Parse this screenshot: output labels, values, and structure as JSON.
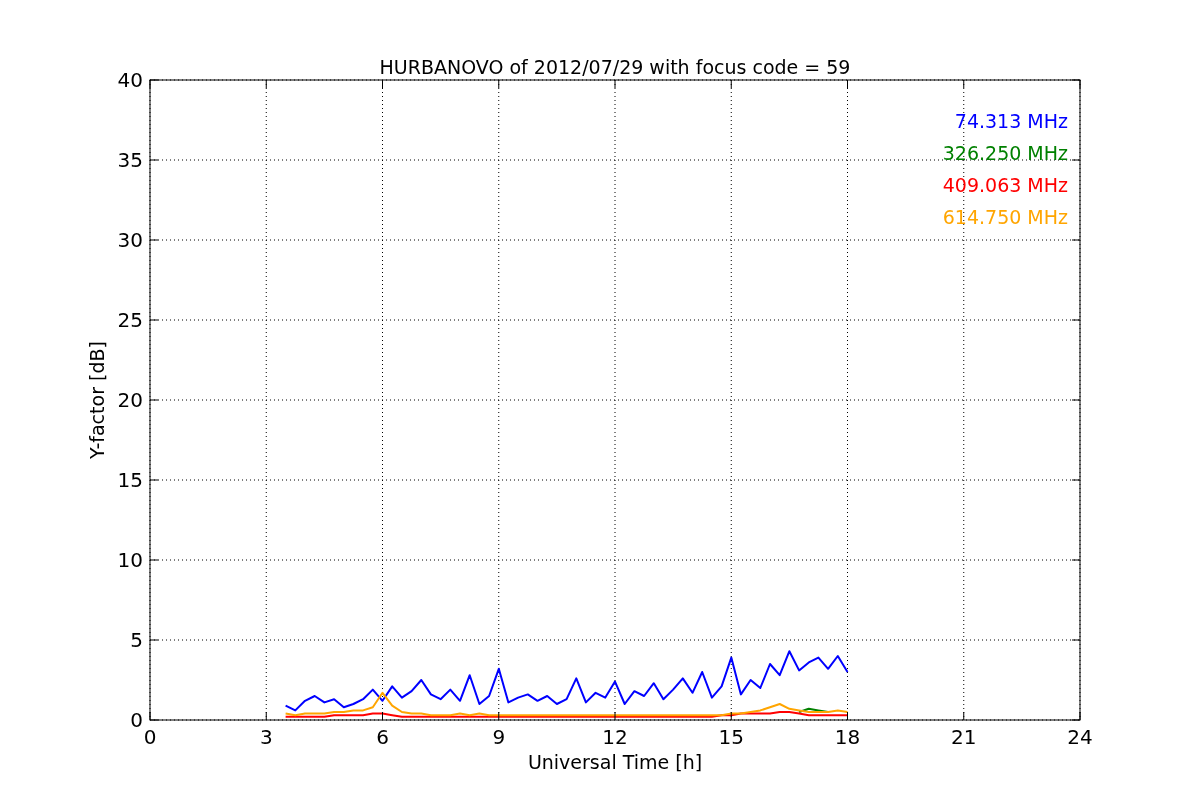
{
  "chart_data": {
    "type": "line",
    "title": "HURBANOVO of 2012/07/29 with focus code = 59",
    "xlabel": "Universal Time [h]",
    "ylabel": "Y-factor [dB]",
    "xlim": [
      0,
      24
    ],
    "ylim": [
      0,
      40
    ],
    "xticks": [
      0,
      3,
      6,
      9,
      12,
      15,
      18,
      21,
      24
    ],
    "yticks": [
      0,
      5,
      10,
      15,
      20,
      25,
      30,
      35,
      40
    ],
    "grid": true,
    "x": [
      3.5,
      3.75,
      4,
      4.25,
      4.5,
      4.75,
      5,
      5.25,
      5.5,
      5.75,
      6,
      6.25,
      6.5,
      6.75,
      7,
      7.25,
      7.5,
      7.75,
      8,
      8.25,
      8.5,
      8.75,
      9,
      9.25,
      9.5,
      9.75,
      10,
      10.25,
      10.5,
      10.75,
      11,
      11.25,
      11.5,
      11.75,
      12,
      12.25,
      12.5,
      12.75,
      13,
      13.25,
      13.5,
      13.75,
      14,
      14.25,
      14.5,
      14.75,
      15,
      15.25,
      15.5,
      15.75,
      16,
      16.25,
      16.5,
      16.75,
      17,
      17.25,
      17.5,
      17.75,
      18
    ],
    "series": [
      {
        "name": "74.313 MHz",
        "color": "#0000ff",
        "values": [
          0.9,
          0.6,
          1.2,
          1.5,
          1.1,
          1.3,
          0.8,
          1.0,
          1.3,
          1.9,
          1.2,
          2.1,
          1.4,
          1.8,
          2.5,
          1.6,
          1.3,
          1.9,
          1.2,
          2.8,
          1.0,
          1.5,
          3.2,
          1.1,
          1.4,
          1.6,
          1.2,
          1.5,
          1.0,
          1.3,
          2.6,
          1.1,
          1.7,
          1.4,
          2.4,
          1.0,
          1.8,
          1.5,
          2.3,
          1.3,
          1.9,
          2.6,
          1.7,
          3.0,
          1.4,
          2.1,
          3.9,
          1.6,
          2.5,
          2.0,
          3.5,
          2.8,
          4.3,
          3.1,
          3.6,
          3.9,
          3.2,
          4.0,
          3.0
        ]
      },
      {
        "name": "326.250 MHz",
        "color": "#008000",
        "values": [
          null,
          null,
          null,
          null,
          null,
          null,
          null,
          null,
          null,
          null,
          null,
          null,
          null,
          null,
          null,
          null,
          null,
          null,
          null,
          null,
          null,
          null,
          null,
          null,
          null,
          null,
          null,
          null,
          null,
          null,
          null,
          null,
          null,
          null,
          null,
          null,
          null,
          null,
          null,
          null,
          null,
          null,
          null,
          null,
          null,
          null,
          null,
          null,
          null,
          null,
          null,
          null,
          null,
          0.5,
          0.7,
          0.6,
          0.5,
          null,
          null
        ]
      },
      {
        "name": "409.063 MHz",
        "color": "#ff0000",
        "values": [
          0.2,
          0.2,
          0.2,
          0.2,
          0.2,
          0.3,
          0.3,
          0.3,
          0.3,
          0.4,
          0.4,
          0.3,
          0.2,
          0.2,
          0.2,
          0.2,
          0.2,
          0.2,
          0.2,
          0.2,
          0.2,
          0.2,
          0.2,
          0.2,
          0.2,
          0.2,
          0.2,
          0.2,
          0.2,
          0.2,
          0.2,
          0.2,
          0.2,
          0.2,
          0.2,
          0.2,
          0.2,
          0.2,
          0.2,
          0.2,
          0.2,
          0.2,
          0.2,
          0.2,
          0.2,
          0.3,
          0.3,
          0.4,
          0.4,
          0.4,
          0.4,
          0.5,
          0.5,
          0.4,
          0.3,
          0.3,
          0.3,
          0.3,
          0.3
        ]
      },
      {
        "name": "614.750 MHz",
        "color": "#ffa500",
        "values": [
          0.4,
          0.3,
          0.4,
          0.4,
          0.4,
          0.5,
          0.5,
          0.6,
          0.6,
          0.8,
          1.7,
          0.9,
          0.5,
          0.4,
          0.4,
          0.3,
          0.3,
          0.3,
          0.4,
          0.3,
          0.4,
          0.3,
          0.3,
          0.3,
          0.3,
          0.3,
          0.3,
          0.3,
          0.3,
          0.3,
          0.3,
          0.3,
          0.3,
          0.3,
          0.3,
          0.3,
          0.3,
          0.3,
          0.3,
          0.3,
          0.3,
          0.3,
          0.3,
          0.3,
          0.3,
          0.3,
          0.4,
          0.4,
          0.5,
          0.6,
          0.8,
          1.0,
          0.7,
          0.6,
          0.5,
          0.5,
          0.5,
          0.6,
          0.5
        ]
      }
    ]
  }
}
